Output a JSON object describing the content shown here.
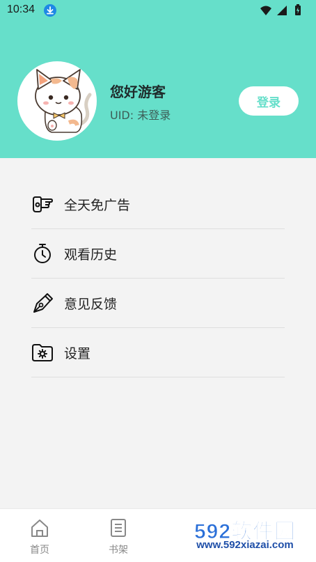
{
  "status_bar": {
    "time": "10:34"
  },
  "profile": {
    "greeting": "您好游客",
    "uid_text": "UID: 未登录",
    "login_label": "登录"
  },
  "menu": [
    {
      "label": "全天免广告",
      "icon": "pointing-hand-icon"
    },
    {
      "label": "观看历史",
      "icon": "stopwatch-icon"
    },
    {
      "label": "意见反馈",
      "icon": "pen-nib-icon"
    },
    {
      "label": "设置",
      "icon": "settings-folder-icon"
    }
  ],
  "bottom_nav": [
    {
      "label": "首页",
      "icon": "home-icon"
    },
    {
      "label": "书架",
      "icon": "bookshelf-icon"
    }
  ],
  "watermark": {
    "brand": "592软件园",
    "url": "www.592xiazai.com"
  },
  "colors": {
    "header_bg": "#66dfca",
    "accent": "#66dfca",
    "page_bg": "#f3f3f3"
  }
}
